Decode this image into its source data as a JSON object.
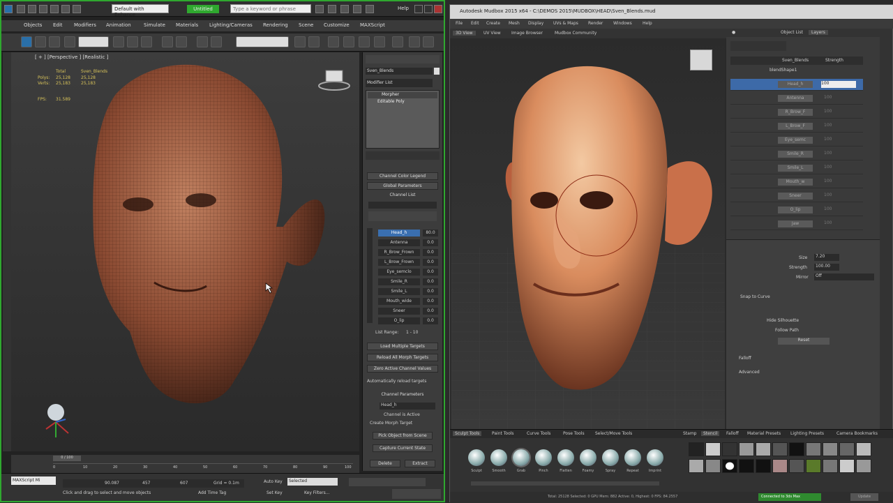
{
  "max": {
    "title": {
      "workspace": "Default with Enhance",
      "product": "Untitled",
      "search_placeholder": "Type a keyword or phrase",
      "help": "Help"
    },
    "menu": [
      "Objects",
      "Edit",
      "Modifiers",
      "Animation",
      "Simulate",
      "Materials",
      "Lighting/Cameras",
      "Rendering",
      "Scene",
      "Customize",
      "MAXScript"
    ],
    "viewport": {
      "label": "[ + ] [Perspective ] [Realistic ]",
      "stats": [
        [
          "Total",
          "Sven_Blends"
        ],
        [
          "Polys:",
          "25,128",
          "25,128"
        ],
        [
          "Verts:",
          "25,183",
          "25,183"
        ],
        [
          "FPS:",
          "31.589"
        ]
      ]
    },
    "cmd": {
      "object_name": "Sven_Blends",
      "modifier_list": "Modifier List",
      "stack": [
        "Morpher",
        "Editable Poly"
      ],
      "rollouts": [
        "Channel Color Legend",
        "Global Parameters",
        "Channel List"
      ],
      "channels": [
        {
          "name": "Head_h",
          "val": "80.0"
        },
        {
          "name": "Antenna",
          "val": "0.0"
        },
        {
          "name": "R_Brow_Frown",
          "val": "0.0"
        },
        {
          "name": "L_Brow_Frown",
          "val": "0.0"
        },
        {
          "name": "Eye_semclo",
          "val": "0.0"
        },
        {
          "name": "Smile_R",
          "val": "0.0"
        },
        {
          "name": "Smile_L",
          "val": "0.0"
        },
        {
          "name": "Mouth_wide",
          "val": "0.0"
        },
        {
          "name": "Sneer",
          "val": "0.0"
        },
        {
          "name": "O_lip",
          "val": "0.0"
        }
      ],
      "buttons": [
        "Load Multiple Targets",
        "Reload All Morph Targets",
        "Zero Active Channel Values"
      ],
      "range_label": "List Range:",
      "range": "1 - 10",
      "auto_reload": "Automatically reload targets",
      "channel_params": "Channel Parameters",
      "channel_field": "Head_h",
      "channel_active": "Channel is Active",
      "create_morph": "Create Morph Target",
      "pick": "Pick Object from Scene",
      "capture": "Capture Current State",
      "delete": "Delete",
      "extract": "Extract"
    },
    "timeline": {
      "frame": "0 / 100",
      "ticks": [
        "0",
        "10",
        "20",
        "30",
        "40",
        "50",
        "60",
        "70",
        "80",
        "90",
        "100"
      ]
    },
    "status": {
      "script_label": "MAXScript Mi",
      "hint": "Click and drag to select and move objects",
      "add_time_tag": "Add Time Tag",
      "auto_key": "Auto Key",
      "set_key": "Set Key",
      "selected": "Selected",
      "key_filters": "Key Filters...",
      "x": "90.087",
      "y": "457",
      "z": "607",
      "grid": "Grid = 0.1m"
    }
  },
  "mudbox": {
    "title": "Autodesk Mudbox 2015 x64 - C:\\DEMOS 2015\\MUDBOX\\HEAD\\Sven_Blends.mud",
    "menu": [
      "File",
      "Edit",
      "Create",
      "Mesh",
      "Display",
      "UVs & Maps",
      "Render",
      "Windows",
      "Help"
    ],
    "view_tabs": [
      "3D View",
      "UV View",
      "Image Browser",
      "Mudbox Community"
    ],
    "panel_tabs": [
      "Object List",
      "Layers"
    ],
    "layers_header": [
      "",
      "Sven_Blends",
      "Strength"
    ],
    "layers_group": "blendShape1",
    "layers": [
      {
        "name": "Head_h",
        "val": "100"
      },
      {
        "name": "Antenna",
        "val": "100"
      },
      {
        "name": "R_Brow_F",
        "val": "100"
      },
      {
        "name": "L_Brow_F",
        "val": "100"
      },
      {
        "name": "Eye_semc",
        "val": "100"
      },
      {
        "name": "Smile_R",
        "val": "100"
      },
      {
        "name": "Smile_L",
        "val": "100"
      },
      {
        "name": "Mouth_w",
        "val": "100"
      },
      {
        "name": "Sneer",
        "val": "100"
      },
      {
        "name": "O_lip",
        "val": "100"
      },
      {
        "name": "Jaw",
        "val": "100"
      }
    ],
    "props": {
      "size_label": "Size",
      "size": "7.20",
      "strength_label": "Strength",
      "strength": "100.00",
      "mirror_label": "Mirror",
      "mirror": "Off",
      "snap": "Snap to Curve",
      "hide_silhouette": "Hide Silhouette",
      "follow_path": "Follow Path",
      "reset": "Reset",
      "falloff": "Falloff",
      "advanced": "Advanced"
    },
    "tray_tabs": [
      "Sculpt Tools",
      "Paint Tools",
      "Curve Tools",
      "Pose Tools",
      "Select/Move Tools"
    ],
    "tools": [
      "Sculpt",
      "Smooth",
      "Grab",
      "Pinch",
      "Flatten",
      "Foamy",
      "Spray",
      "Repeat",
      "Imprint"
    ],
    "right_tray_tabs": [
      "Stamp",
      "Stencil",
      "Falloff",
      "Material Presets",
      "Lighting Presets",
      "Camera Bookmarks"
    ],
    "status": {
      "text": "Total: 25128  Selected: 0  GPU Mem: 882  Active: 0, Highest: 0  FPS: 84.2557",
      "right": "Connected to 3ds Max",
      "update": "Update"
    }
  }
}
